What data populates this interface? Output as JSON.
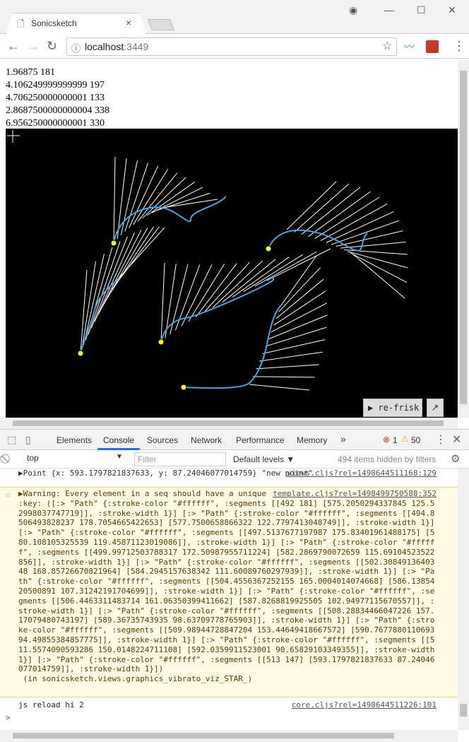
{
  "browser": {
    "tab_title": "Sonicsketch",
    "url_host": "localhost",
    "url_port": ":3449"
  },
  "readout": {
    "lines": [
      "1.96875 181",
      "4.106249999999999 197",
      "4.706250000000001 133",
      "2.8687500000000004 338",
      "6.956250000000001 330"
    ]
  },
  "page": {
    "refrisk_label": "▶ re-frisk",
    "popout_label": "↗"
  },
  "devtools": {
    "tabs": [
      "Elements",
      "Console",
      "Sources",
      "Network",
      "Performance",
      "Memory"
    ],
    "more": "»",
    "error_count": "1",
    "warning_count": "50",
    "context": "top",
    "filter_placeholder": "Filter",
    "levels": "Default levels ▼",
    "hidden_count": "494 items hidden by filters"
  },
  "console": {
    "msg1_text": "▶Point {x: 593.1797821837633, y: 87.24046077014759} \"new point\"",
    "msg1_src": "views.cljs?rel=1498644511168:129",
    "msg2_text": "▶Warning: Every element in a seq should have a unique\n:key: ([:> \"Path\" {:stroke-color \"#ffffff\", :segments [[492 181] [575.2050294337845 125.52998037747719]], :stroke-width 1}] [:> \"Path\" {:stroke-color \"#ffffff\", :segments [[494.8506493828237 178.7054665422653] [577.7500658866322 122.7797413048749]], :stroke-width 1}] [:> \"Path\" {:stroke-color \"#ffffff\", :segments [[497.5137677197987 175.83401961488175] [580.108105325539 119.45871123019086]], :stroke-width 1}] [:> \"Path\" {:stroke-color \"#ffffff\", :segments [[499.99712503788317 172.50987955711224] [582.2869790072659 115.69104523522856]], :stroke-width 1}] [:> \"Path\" {:stroke-color \"#ffffff\", :segments [[502.3084913640348 168.85726670821964] [584.2945157638342 111.60089760297939]], :stroke-width 1}] [:> \"Path\" {:stroke-color \"#ffffff\", :segments [[504.4556367252155 165.0004014074668] [586.1385420500891 107.31242191704699]], :stroke-width 1}] [:> \"Path\" {:stroke-color \"#ffffff\", :segments [[506.4463311483714 161.06350399411662] [587.8268819925505 102.94977115670557]], :stroke-width 1}] [:> \"Path\" {:stroke-color \"#ffffff\", :segments [[508.28834466047226 157.17079480743197] [589.36735743935 98.63709778765903]], :stroke-width 1}] [:> \"Path\" {:stroke-color \"#ffffff\", :segments [[509.98944728847204 153.44649418667572] [590.7677880110693 94.49855384857775]], :stroke-width 1}] [:> \"Path\" {:stroke-color \"#ffffff\", :segments [[511.5574090593286 150.0148224711108] [592.0359911523001 90.65829103349355]], :stroke-width 1}] [:> \"Path\" {:stroke-color \"#ffffff\", :segments [[513 147] [593.1797821837633 87.24046077014759]], :stroke-width 1}])\n (in sonicsketch.views.graphics_vibrato_viz_STAR_)",
    "msg2_src": "template.cljs?rel=1498499750588:352",
    "msg3_text": "js reload hi 2",
    "msg3_src": "core.cljs?rel=1498644511226:101",
    "prompt": ">"
  },
  "colors": {
    "curve": "#4aa3df",
    "strokes": "#ffffff",
    "control_point": "#ffff00",
    "active_tab": "#1a73e8"
  }
}
